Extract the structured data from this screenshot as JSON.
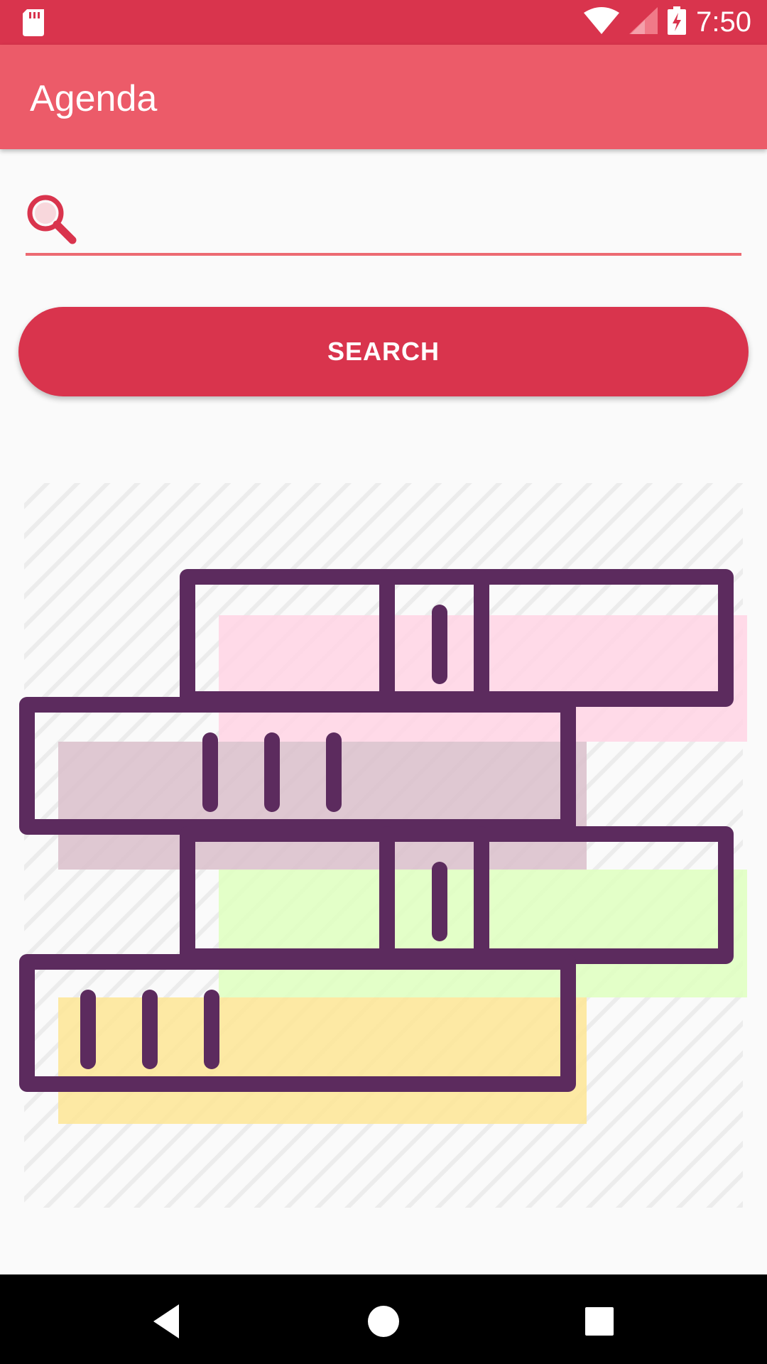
{
  "status_bar": {
    "time": "7:50",
    "icons": [
      "sd-card-icon",
      "wifi-icon",
      "signal-icon",
      "battery-charging-icon"
    ]
  },
  "app_bar": {
    "title": "Agenda"
  },
  "search": {
    "value": "",
    "placeholder": "",
    "icon": "search-icon",
    "button_label": "SEARCH"
  },
  "illustration": {
    "icon": "bookshelf-illustration"
  },
  "nav_bar": {
    "items": [
      "back-icon",
      "home-icon",
      "recents-icon"
    ]
  },
  "colors": {
    "primary_dark": "#d9344d",
    "primary": "#ec5b69",
    "accent_line": "#ec6a72",
    "shelf_stroke": "#5c2b5e",
    "highlight_pink": "#ffd6e6",
    "highlight_mauve": "#dcc2cd",
    "highlight_green": "#e0ffc2",
    "highlight_yellow": "#fde79a",
    "background": "#fafafa"
  }
}
